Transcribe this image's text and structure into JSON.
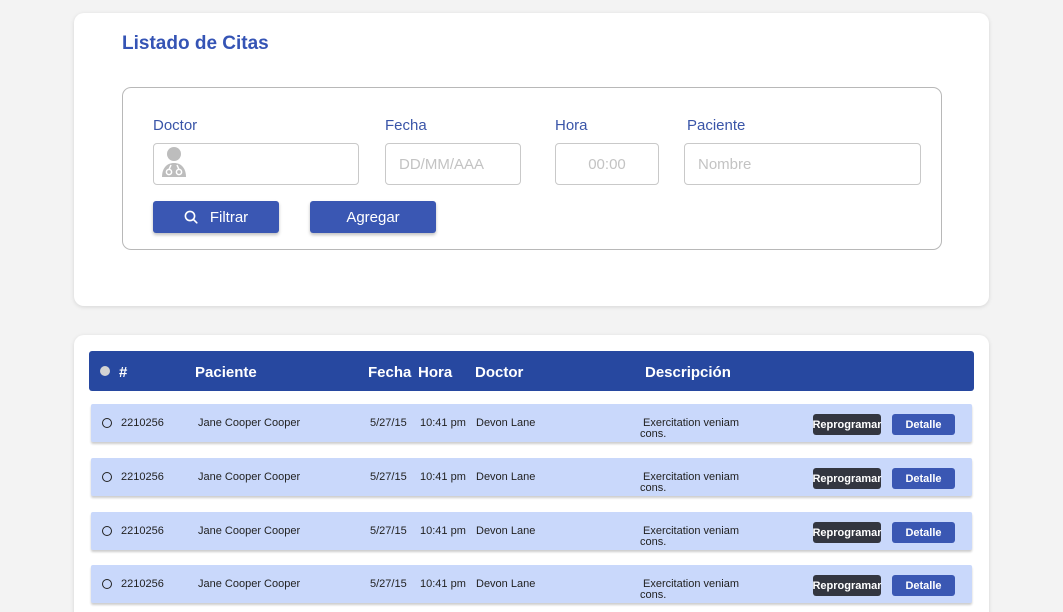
{
  "header": {
    "title": "Listado de Citas"
  },
  "filters": {
    "doctor_label": "Doctor",
    "fecha_label": "Fecha",
    "fecha_placeholder": "DD/MM/AAA",
    "hora_label": "Hora",
    "hora_placeholder": "00:00",
    "paciente_label": "Paciente",
    "paciente_placeholder": "Nombre",
    "filtrar_label": "Filtrar",
    "agregar_label": "Agregar"
  },
  "table": {
    "columns": {
      "id": "#",
      "paciente": "Paciente",
      "fecha": "Fecha",
      "hora": "Hora",
      "doctor": "Doctor",
      "descripcion": "Descripción"
    },
    "rows": [
      {
        "id": "2210256",
        "paciente": "Jane Cooper Cooper",
        "fecha": "5/27/15",
        "hora": "10:41 pm",
        "doctor": "Devon Lane",
        "desc_line1": "Exercitation veniam",
        "desc_line2": "cons.",
        "reprogramar": "Reprogramar",
        "detalle": "Detalle"
      },
      {
        "id": "2210256",
        "paciente": "Jane Cooper Cooper",
        "fecha": "5/27/15",
        "hora": "10:41 pm",
        "doctor": "Devon Lane",
        "desc_line1": "Exercitation veniam",
        "desc_line2": "cons.",
        "reprogramar": "Reprogramar",
        "detalle": "Detalle"
      },
      {
        "id": "2210256",
        "paciente": "Jane Cooper Cooper",
        "fecha": "5/27/15",
        "hora": "10:41 pm",
        "doctor": "Devon Lane",
        "desc_line1": "Exercitation veniam",
        "desc_line2": "cons.",
        "reprogramar": "Reprogramar",
        "detalle": "Detalle"
      },
      {
        "id": "2210256",
        "paciente": "Jane Cooper Cooper",
        "fecha": "5/27/15",
        "hora": "10:41 pm",
        "doctor": "Devon Lane",
        "desc_line1": "Exercitation veniam",
        "desc_line2": "cons.",
        "reprogramar": "Reprogramar",
        "detalle": "Detalle"
      }
    ]
  },
  "colors": {
    "accent": "#3a57b3",
    "header_bg": "#2748a0",
    "row_bg": "#c9d8fb",
    "dark_button": "#333640"
  },
  "icons": {
    "doctor_field": "doctor-icon",
    "filter_button": "search-icon"
  }
}
